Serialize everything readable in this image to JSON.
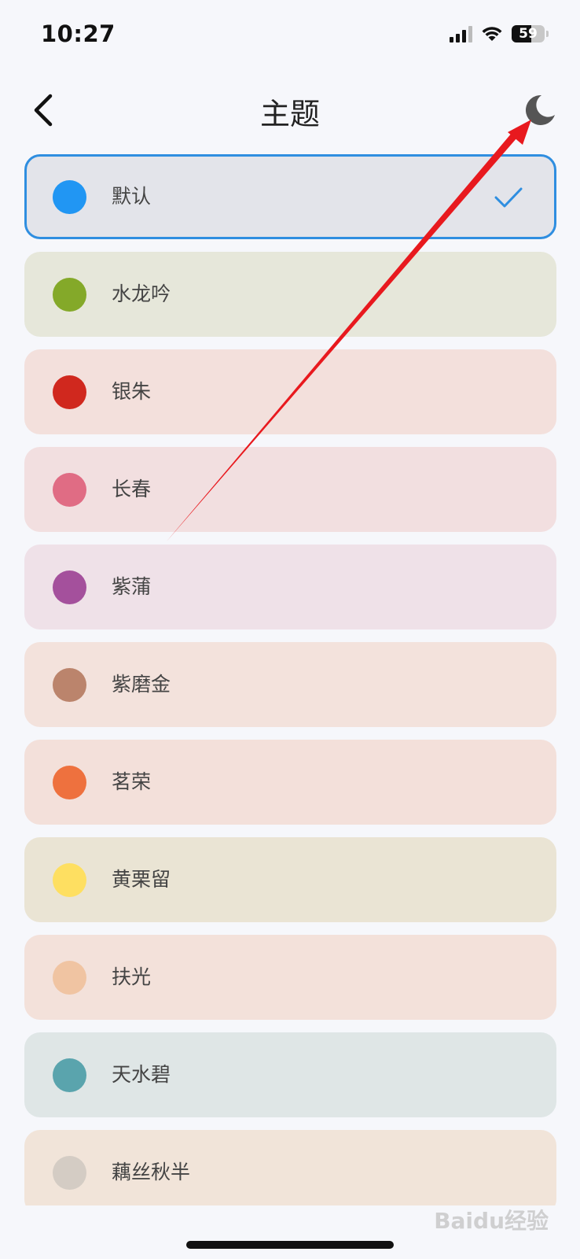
{
  "status_bar": {
    "time": "10:27",
    "battery": "59",
    "battery_level": 0.59
  },
  "header": {
    "title": "主题",
    "back_icon": "chevron-left-icon",
    "action_icon": "moon-icon"
  },
  "themes": [
    {
      "label": "默认",
      "color": "#2196f3",
      "bg": "#e3e4ea",
      "selected": true
    },
    {
      "label": "水龙吟",
      "color": "#84a929",
      "bg": "#e6e7da"
    },
    {
      "label": "银朱",
      "color": "#d0281e",
      "bg": "#f3e0dc"
    },
    {
      "label": "长春",
      "color": "#e06c84",
      "bg": "#f2dfe0"
    },
    {
      "label": "紫蒲",
      "color": "#a4509c",
      "bg": "#efe1e8"
    },
    {
      "label": "紫磨金",
      "color": "#bb846c",
      "bg": "#f3e2dc"
    },
    {
      "label": "茗荣",
      "color": "#ee713e",
      "bg": "#f3e0da"
    },
    {
      "label": "黄栗留",
      "color": "#fedf61",
      "bg": "#eae4d4"
    },
    {
      "label": "扶光",
      "color": "#f0c4a2",
      "bg": "#f3e1da"
    },
    {
      "label": "天水碧",
      "color": "#5aa4ad",
      "bg": "#dfe6e6"
    },
    {
      "label": "藕丝秋半",
      "color": "#d4ccc4",
      "bg": "#f1e4d9"
    }
  ],
  "colors": {
    "accent": "#2f8ee0",
    "annotation": "#e8191e"
  },
  "watermark": "Baidu经验"
}
